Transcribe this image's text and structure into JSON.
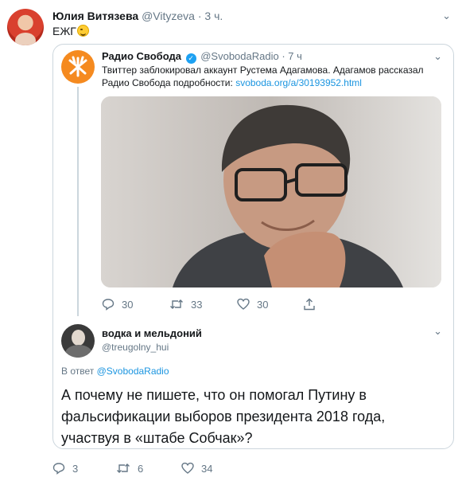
{
  "tweet": {
    "author_name": "Юлия Витязева",
    "author_handle": "@Vityzeva",
    "separator": "·",
    "time": "3 ч.",
    "text": "ЕЖГ",
    "emoji": "winking-face",
    "replies": "3",
    "retweets": "6",
    "likes": "34"
  },
  "quoted": {
    "author_name": "Радио Свобода",
    "author_handle": "@SvobodaRadio",
    "separator": "·",
    "time": "7 ч",
    "text": "Твиттер заблокировал аккаунт Рустема Адагамова. Адагамов рассказал Радио Свобода подробности:",
    "link": "svoboda.org/a/30193952.html",
    "replies": "30",
    "retweets": "33",
    "likes": "30"
  },
  "reply": {
    "author_name": "водка и мельдоний",
    "author_handle": "@treugolny_hui",
    "reply_prefix": "В ответ",
    "reply_to": "@SvobodaRadio",
    "text": "А почему не пишете, что он помогал Путину в фальсификации выборов президента 2018 года, участвуя в «штабе Собчак»?"
  },
  "colors": {
    "link": "#1b95e0",
    "verified": "#1da1f2",
    "muted": "#657786",
    "border": "#ccd6dd",
    "svoboda_brand": "#f58a1f"
  },
  "icons": [
    "chevron-down-icon",
    "verified-icon",
    "reply-icon",
    "retweet-icon",
    "like-icon",
    "share-icon"
  ]
}
